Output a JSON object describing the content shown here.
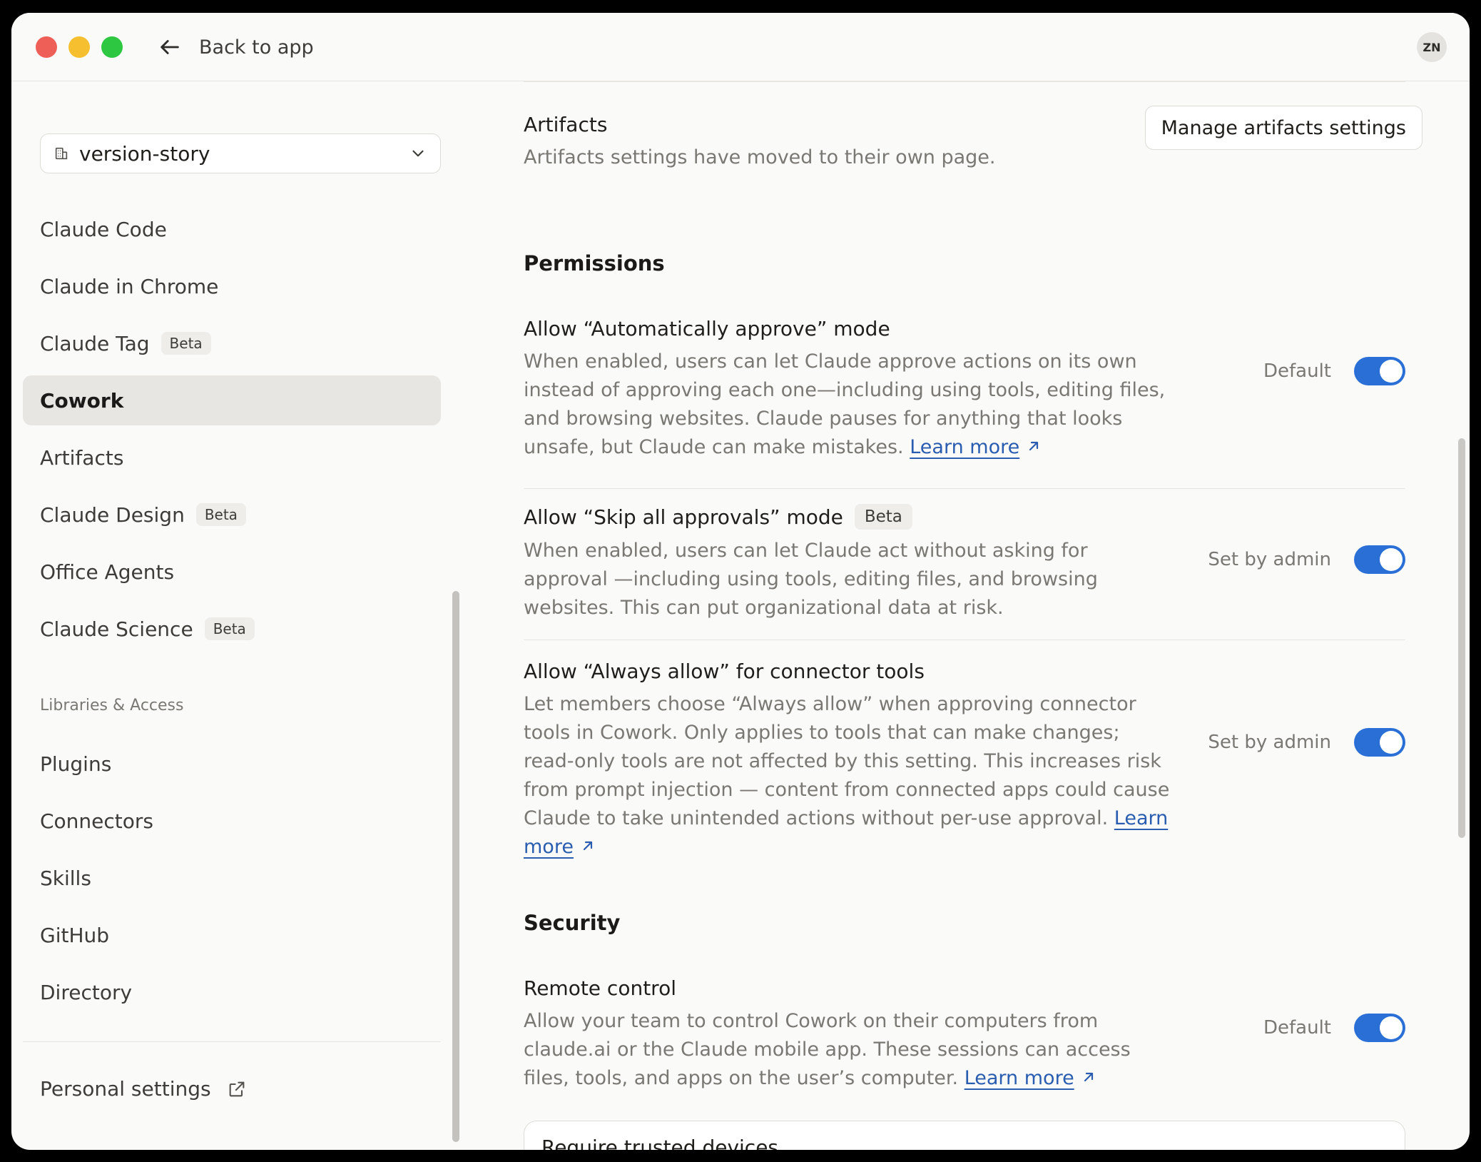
{
  "titlebar": {
    "back_label": "Back to app",
    "avatar_initials": "ZN"
  },
  "sidebar": {
    "workspace": "version-story",
    "items": [
      {
        "label": "Claude Code",
        "badge": ""
      },
      {
        "label": "Claude in Chrome",
        "badge": ""
      },
      {
        "label": "Claude Tag",
        "badge": "Beta"
      },
      {
        "label": "Cowork",
        "badge": "",
        "active": true
      },
      {
        "label": "Artifacts",
        "badge": ""
      },
      {
        "label": "Claude Design",
        "badge": "Beta"
      },
      {
        "label": "Office Agents",
        "badge": ""
      },
      {
        "label": "Claude Science",
        "badge": "Beta"
      }
    ],
    "section_label": "Libraries & Access",
    "library_items": [
      "Plugins",
      "Connectors",
      "Skills",
      "GitHub",
      "Directory"
    ],
    "personal_settings": "Personal settings"
  },
  "main": {
    "artifacts": {
      "title": "Artifacts",
      "description": "Artifacts settings have moved to their own page.",
      "button": "Manage artifacts settings"
    },
    "permissions": {
      "heading": "Permissions",
      "settings": [
        {
          "title": "Allow “Automatically approve” mode",
          "badge": "",
          "description": "When enabled, users can let Claude approve actions on its own instead of approving each one—including using tools, editing files, and browsing websites. Claude pauses for anything that looks unsafe, but Claude can make mistakes.",
          "link": "Learn more",
          "status": "Default",
          "enabled": true
        },
        {
          "title": "Allow “Skip all approvals” mode",
          "badge": "Beta",
          "description": "When enabled, users can let Claude act without asking for approval —including using tools, editing files, and browsing websites. This can put organizational data at risk.",
          "link": "",
          "status": "Set by admin",
          "enabled": true
        },
        {
          "title": "Allow “Always allow” for connector tools",
          "badge": "",
          "description": "Let members choose “Always allow” when approving connector tools in Cowork. Only applies to tools that can make changes; read-only tools are not affected by this setting. This increases risk from prompt injection — content from connected apps could cause Claude to take unintended actions without per-use approval.",
          "link": "Learn more",
          "status": "Set by admin",
          "enabled": true
        }
      ]
    },
    "security": {
      "heading": "Security",
      "settings": [
        {
          "title": "Remote control",
          "description": "Allow your team to control Cowork on their computers from claude.ai or the Claude mobile app. These sessions can access files, tools, and apps on the user’s computer.",
          "link": "Learn more",
          "status": "Default",
          "enabled": true
        }
      ],
      "trusted_devices": "Require trusted devices"
    }
  },
  "colors": {
    "toggle_on": "#2a6fd6",
    "link": "#2a5db0",
    "active_nav_bg": "#e7e6e3"
  }
}
